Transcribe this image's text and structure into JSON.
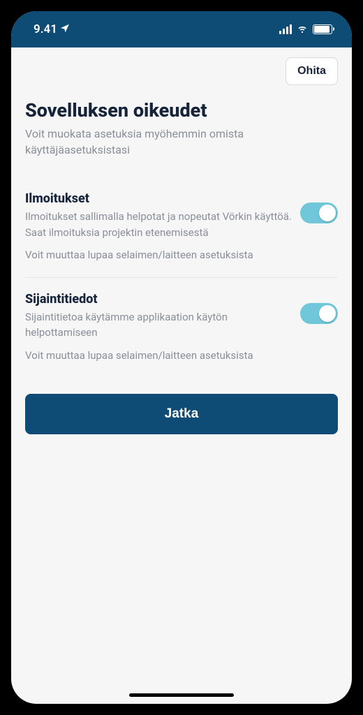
{
  "status": {
    "time": "9.41"
  },
  "actions": {
    "skip_label": "Ohita",
    "continue_label": "Jatka"
  },
  "header": {
    "title": "Sovelluksen oikeudet",
    "subtitle": "Voit muokata asetuksia myöhemmin omista käyttäjäasetuksistasi"
  },
  "sections": [
    {
      "title": "Ilmoitukset",
      "description": "Ilmoitukset sallimalla helpotat ja nopeutat Vörkin käyttöä. Saat ilmoituksia projektin etenemisestä",
      "note": "Voit muuttaa lupaa selaimen/laitteen asetuksista",
      "toggle_on": true
    },
    {
      "title": "Sijaintitiedot",
      "description": "Sijaintitietoa käytämme applikaation käytön helpottamiseen",
      "note": "Voit muuttaa lupaa selaimen/laitteen asetuksista",
      "toggle_on": true
    }
  ]
}
